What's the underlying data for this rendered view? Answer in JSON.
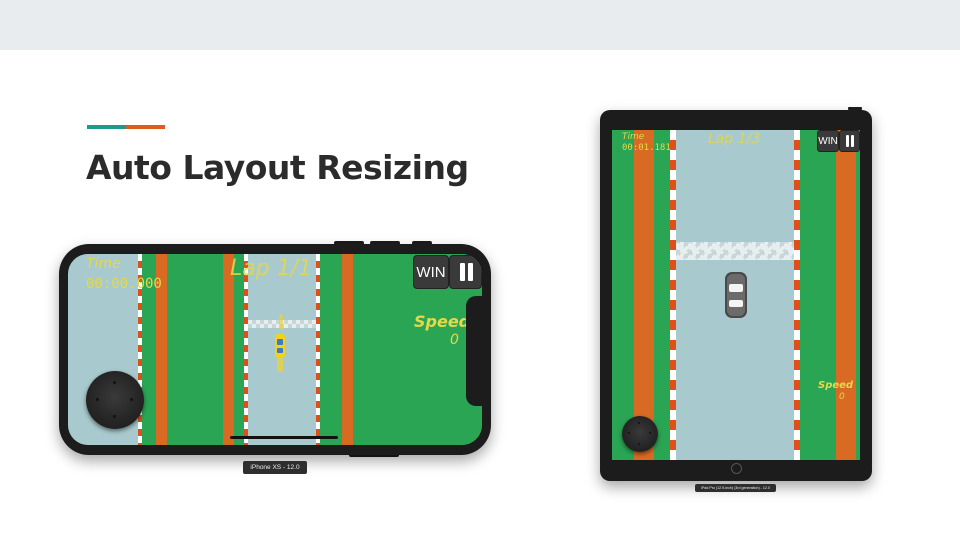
{
  "slide": {
    "title": "Auto Layout Resizing",
    "accent_colors": [
      "#1d9a8e",
      "#e05c1c"
    ]
  },
  "phone": {
    "device_label": "iPhone XS - 12.0",
    "hud": {
      "time_label": "Time",
      "time_value": "00:00.000",
      "lap_text": "Lap 1/1",
      "speed_label": "Speed",
      "speed_value": "0",
      "win_label": "WIN"
    },
    "car_color": "#f1d21c",
    "joystick_icon": "joystick-icon",
    "pause_icon": "pause-icon"
  },
  "ipad": {
    "device_label": "iPad Pro (12.9-inch) (3rd generation) - 12.0",
    "hud": {
      "time_label": "Time",
      "time_value": "00:01.181",
      "lap_text": "Lap 1/3",
      "speed_label": "Speed",
      "speed_value": "0",
      "win_label": "WIN"
    },
    "car_color": "#5a5a5a",
    "joystick_icon": "joystick-icon",
    "pause_icon": "pause-icon"
  }
}
